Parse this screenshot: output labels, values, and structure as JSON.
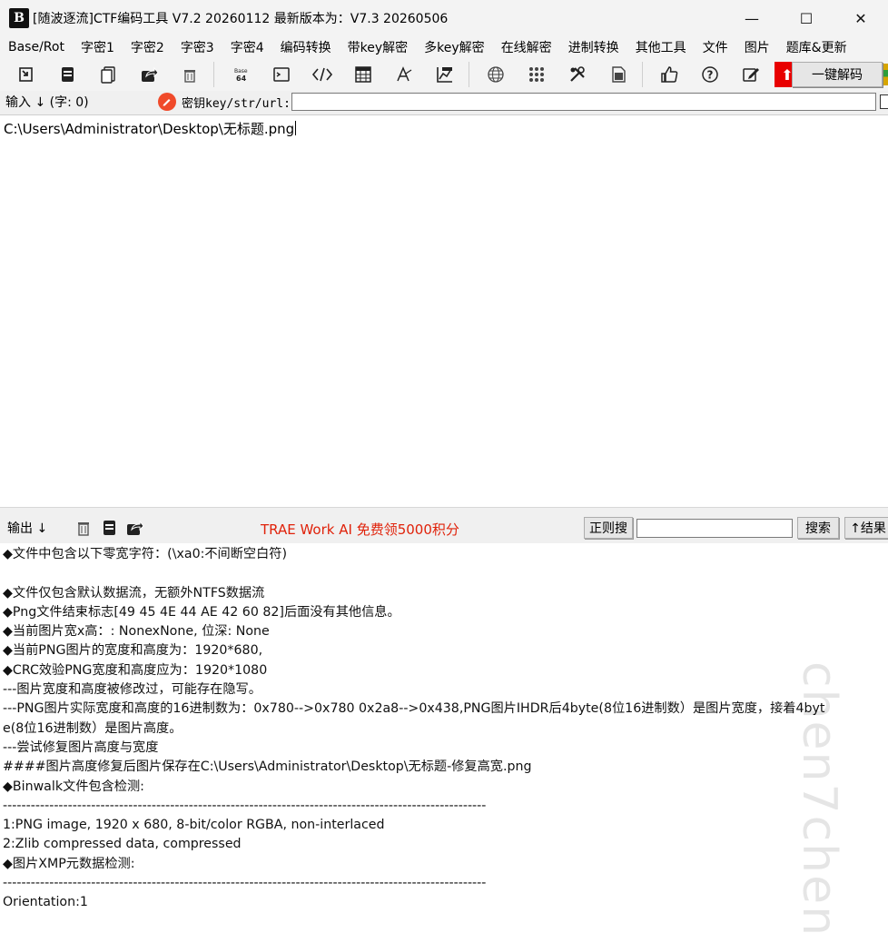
{
  "window": {
    "logo": "B",
    "title": "[随波逐流]CTF编码工具 V7.2 20260112    最新版本为：V7.3  20260506",
    "minimize": "—",
    "maximize": "☐",
    "close": "✕"
  },
  "menu": {
    "items": [
      "Base/Rot",
      "字密1",
      "字密2",
      "字密3",
      "字密4",
      "编码转换",
      "带key解密",
      "多key解密",
      "在线解密",
      "进制转换",
      "其他工具",
      "文件",
      "图片",
      "题库&更新"
    ]
  },
  "toolbar": {
    "decode_label": "一键解码",
    "upload_glyph": "⬆"
  },
  "input": {
    "label": "输入 ↓ (字: 0)",
    "key_label": "密钥key/str/url:",
    "key_value": "",
    "text": "C:\\Users\\Administrator\\Desktop\\无标题.png"
  },
  "output": {
    "label": "输出 ↓",
    "ad_text": "TRAE Work AI 免费领5000积分",
    "regex_search_label": "正则搜",
    "search_value": "",
    "search_label": "搜索",
    "result_label": "↑结果",
    "lines": [
      "◆文件中包含以下零宽字符：(\\xa0:不间断空白符)",
      "",
      "◆文件仅包含默认数据流，无额外NTFS数据流",
      "◆Png文件结束标志[49 45 4E 44 AE 42 60 82]后面没有其他信息。",
      "◆当前图片宽x高：: NonexNone, 位深: None",
      "◆当前PNG图片的宽度和高度为：1920*680,",
      "◆CRC效验PNG宽度和高度应为：1920*1080",
      "---图片宽度和高度被修改过，可能存在隐写。",
      "---PNG图片实际宽度和高度的16进制数为：0x780-->0x780 0x2a8-->0x438,PNG图片IHDR后4byte(8位16进制数）是图片宽度，接着4byt",
      "e(8位16进制数）是图片高度。",
      "---尝试修复图片高度与宽度",
      "####图片高度修复后图片保存在C:\\Users\\Administrator\\Desktop\\无标题-修复高宽.png",
      "◆Binwalk文件包含检测:",
      "--------------------------------------------------------------------------------------------------------",
      "1:PNG image, 1920 x 680, 8-bit/color RGBA, non-interlaced",
      "2:Zlib compressed data, compressed",
      "◆图片XMP元数据检测:",
      "--------------------------------------------------------------------------------------------------------",
      "Orientation:1"
    ],
    "watermark": "chen7chen"
  },
  "colors": {
    "upload_red": "#e80000",
    "key_icon": "#f04a2a",
    "ad_text": "#e0220a"
  },
  "icons": {
    "toolbar": [
      "import-icon",
      "copy-all-icon",
      "paste-icon",
      "share-icon",
      "trash-icon",
      "base64-icon",
      "terminal-icon",
      "code-icon",
      "calculator-icon",
      "font-icon",
      "graph-icon",
      "globe-icon",
      "grid-icon",
      "tools-icon",
      "document-icon",
      "thumbs-up-icon",
      "help-icon",
      "edit-icon",
      "upload-icon"
    ]
  }
}
